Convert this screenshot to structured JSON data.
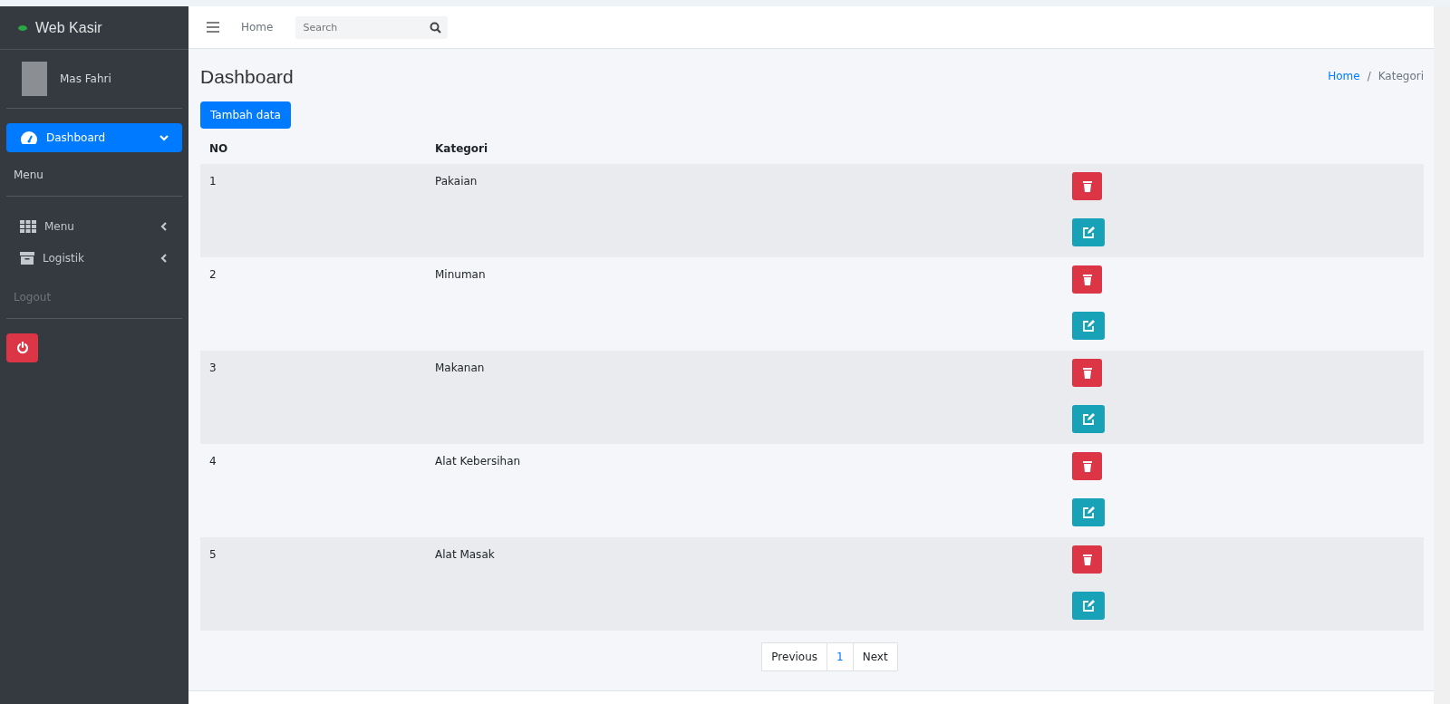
{
  "brand": {
    "name": "Web Kasir"
  },
  "user": {
    "name": "Mas Fahri"
  },
  "sidebar": {
    "items": [
      {
        "kind": "link",
        "label": "Dashboard",
        "selected": true,
        "expanded": true
      },
      {
        "kind": "header",
        "label": "Menu"
      },
      {
        "kind": "divider"
      },
      {
        "kind": "link",
        "label": "Menu",
        "selected": false,
        "expanded": false
      },
      {
        "kind": "link",
        "label": "Logistik",
        "selected": false,
        "expanded": false
      },
      {
        "kind": "muted",
        "label": "Logout"
      },
      {
        "kind": "divider"
      },
      {
        "kind": "power"
      }
    ]
  },
  "topbar": {
    "home": "Home",
    "search": {
      "placeholder": "Search"
    }
  },
  "page": {
    "title": "Dashboard",
    "breadcrumb_separator": "/",
    "breadcrumb": [
      {
        "label": "Home",
        "link": true
      },
      {
        "label": "Kategori",
        "link": false
      }
    ],
    "add_button": "Tambah data"
  },
  "table": {
    "columns": [
      "NO",
      "Kategori"
    ],
    "rows": [
      {
        "no": "1",
        "kategori": "Pakaian"
      },
      {
        "no": "2",
        "kategori": "Minuman"
      },
      {
        "no": "3",
        "kategori": "Makanan"
      },
      {
        "no": "4",
        "kategori": "Alat Kebersihan"
      },
      {
        "no": "5",
        "kategori": "Alat Masak"
      }
    ]
  },
  "pagination": [
    {
      "label": "Previous",
      "selected": false
    },
    {
      "label": "1",
      "selected": true
    },
    {
      "label": "Next",
      "selected": false
    }
  ]
}
